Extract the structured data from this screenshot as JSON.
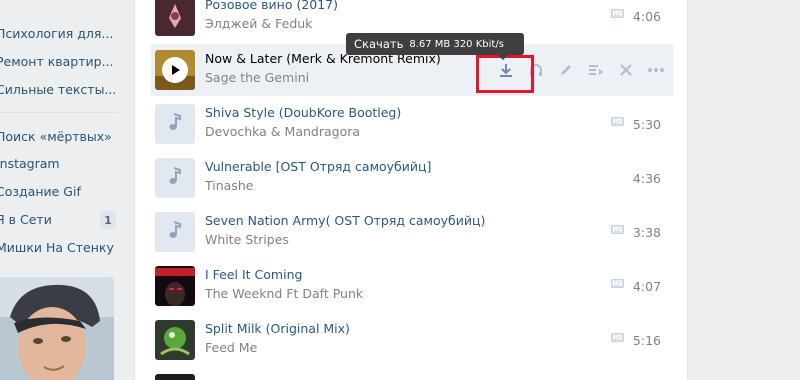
{
  "sidebar": {
    "items": [
      {
        "label": "Психология для..."
      },
      {
        "label": "Ремонт квартир..."
      },
      {
        "label": "Сильные тексты..."
      },
      {
        "label": "Поиск «мёртвых»"
      },
      {
        "label": "Instagram"
      },
      {
        "label": "Создание Gif"
      },
      {
        "label": "Я в Сети",
        "badge": "1"
      },
      {
        "label": "Мишки На Стенку"
      }
    ]
  },
  "tooltip": {
    "label": "Скачать",
    "info": "8.67 MB 320 Kbit/s"
  },
  "tracks": [
    {
      "title": "Розовое вино (2017)",
      "artist": "Элджей & Feduk",
      "hq": "HQ",
      "duration": "4:06"
    },
    {
      "title": "Now & Later (Merk & Kremont Remix)",
      "artist": "Sage the Gemini",
      "playing": true
    },
    {
      "title": "Shiva Style (DoubKore Bootleg)",
      "artist": "Devochka & Mandragora",
      "hq": "HQ",
      "duration": "5:30"
    },
    {
      "title": "Vulnerable [OST Отряд самоубийц]",
      "artist": "Tinashe",
      "duration": "4:36"
    },
    {
      "title": "Seven Nation Army( OST Отряд самоубийц)",
      "artist": "White Stripes",
      "hq": "HQ",
      "duration": "3:38"
    },
    {
      "title": "I Feel It Coming",
      "artist": "The Weeknd Ft Daft Punk",
      "hq": "HQ",
      "duration": "4:07"
    },
    {
      "title": "Split Milk (Original Mix)",
      "artist": "Feed Me",
      "hq": "HQ",
      "duration": "5:16"
    }
  ],
  "colors": {
    "link": "#2a5885",
    "highlight": "#e2162d",
    "row_active": "#edf0f5"
  }
}
